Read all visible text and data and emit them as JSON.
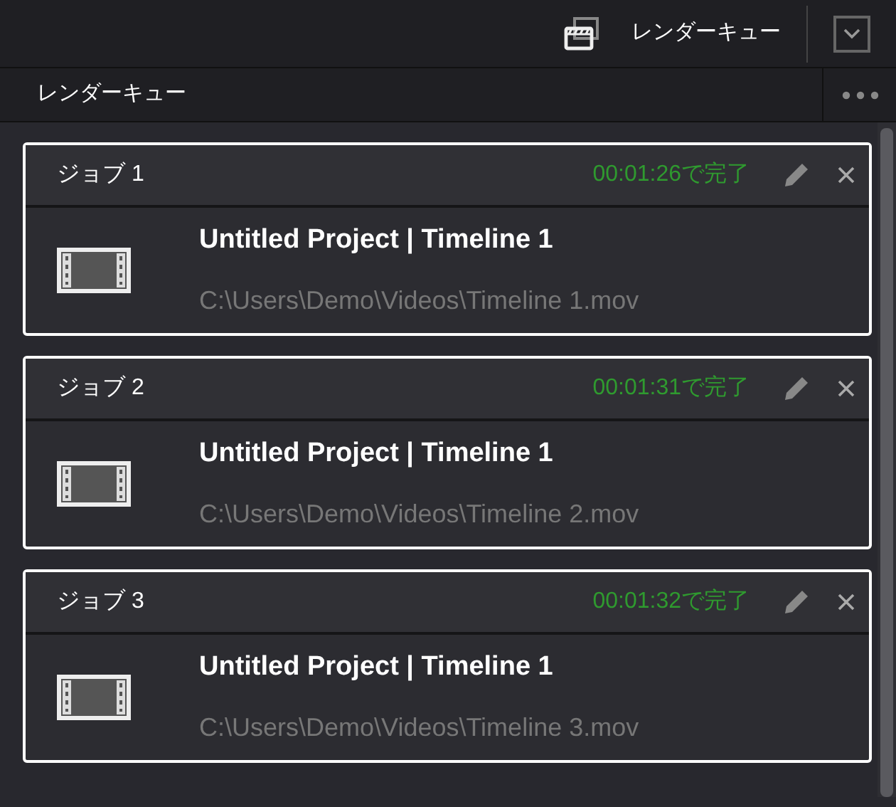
{
  "toolbar": {
    "title": "レンダーキュー"
  },
  "panel": {
    "title": "レンダーキュー"
  },
  "jobs": [
    {
      "name": "ジョブ 1",
      "status": "00:01:26で完了",
      "title": "Untitled Project | Timeline 1",
      "path": "C:\\Users\\Demo\\Videos\\Timeline 1.mov",
      "selected": true
    },
    {
      "name": "ジョブ 2",
      "status": "00:01:31で完了",
      "title": "Untitled Project | Timeline 1",
      "path": "C:\\Users\\Demo\\Videos\\Timeline 2.mov",
      "selected": true
    },
    {
      "name": "ジョブ 3",
      "status": "00:01:32で完了",
      "title": "Untitled Project | Timeline 1",
      "path": "C:\\Users\\Demo\\Videos\\Timeline 3.mov",
      "selected": true
    }
  ]
}
